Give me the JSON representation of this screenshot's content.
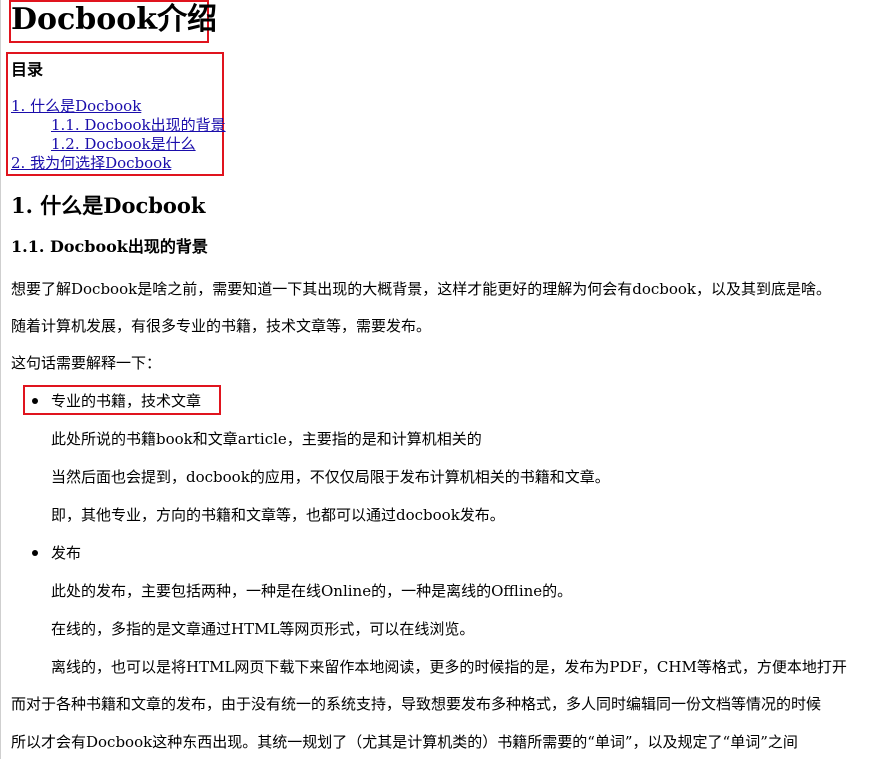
{
  "title": "Docbook介绍",
  "toc": {
    "heading": "目录",
    "items": [
      "1. 什么是Docbook",
      "1.1. Docbook出现的背景",
      "1.2. Docbook是什么",
      "2. 我为何选择Docbook"
    ]
  },
  "section1": {
    "heading": "1. 什么是Docbook",
    "sub_heading": "1.1. Docbook出现的背景",
    "p1": "想要了解Docbook是啥之前，需要知道一下其出现的大概背景，这样才能更好的理解为何会有docbook，以及其到底是啥。",
    "p2": "随着计算机发展，有很多专业的书籍，技术文章等，需要发布。",
    "p3": "这句话需要解释一下：",
    "bullets": [
      {
        "label": "专业的书籍，技术文章",
        "lines": [
          "此处所说的书籍book和文章article，主要指的是和计算机相关的",
          "当然后面也会提到，docbook的应用，不仅仅局限于发布计算机相关的书籍和文章。",
          "即，其他专业，方向的书籍和文章等，也都可以通过docbook发布。"
        ]
      },
      {
        "label": "发布",
        "lines": [
          "此处的发布，主要包括两种，一种是在线Online的，一种是离线的Offline的。",
          "在线的，多指的是文章通过HTML等网页形式，可以在线浏览。",
          "离线的，也可以是将HTML网页下载下来留作本地阅读，更多的时候指的是，发布为PDF，CHM等格式，方便本地打开"
        ]
      }
    ],
    "p4": "而对于各种书籍和文章的发布，由于没有统一的系统支持，导致想要发布多种格式，多人同时编辑同一份文档等情况的时候",
    "p5": "所以才会有Docbook这种东西出现。其统一规划了（尤其是计算机类的）书籍所需要的“单词”，以及规定了“单词”之间"
  },
  "colors": {
    "link": "#1a0dab",
    "highlight_box": "#e0141e"
  }
}
